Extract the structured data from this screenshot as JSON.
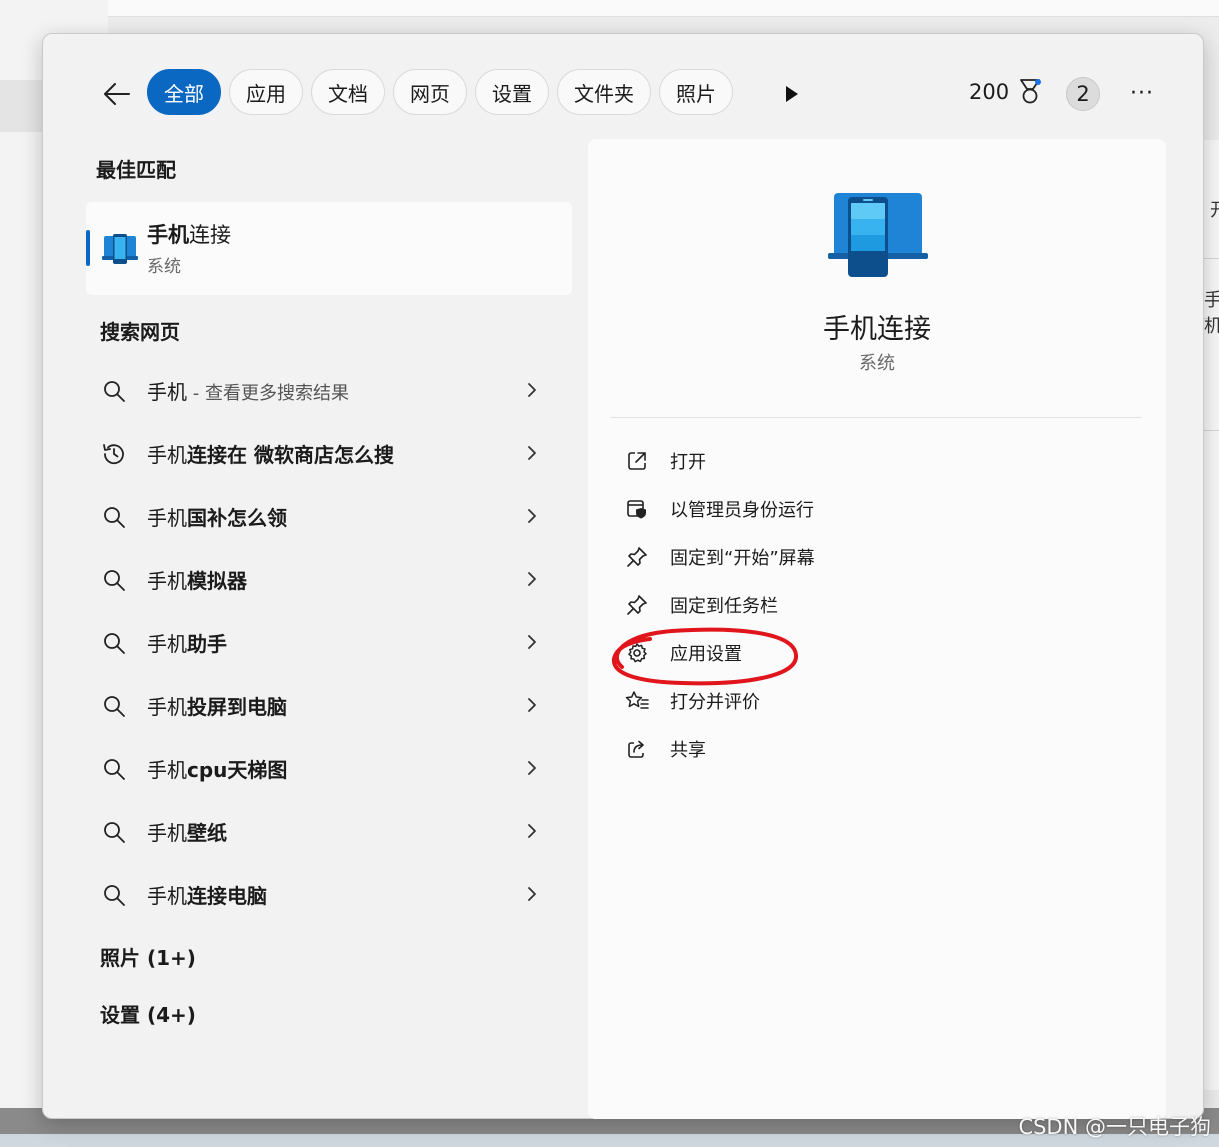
{
  "filters": {
    "chips": [
      {
        "label": "全部",
        "active": true
      },
      {
        "label": "应用",
        "active": false
      },
      {
        "label": "文档",
        "active": false
      },
      {
        "label": "网页",
        "active": false
      },
      {
        "label": "设置",
        "active": false
      },
      {
        "label": "文件夹",
        "active": false
      },
      {
        "label": "照片",
        "active": false
      }
    ],
    "points": "200",
    "badge_count": "2",
    "more_label": "···"
  },
  "best_match": {
    "heading": "最佳匹配",
    "title_bold": "手机",
    "title_rest": "连接",
    "subtitle": "系统"
  },
  "web_search": {
    "heading": "搜索网页",
    "items": [
      {
        "prefix": "手机",
        "bold": "",
        "muted": " - 查看更多搜索结果",
        "icon": "search-icon"
      },
      {
        "prefix": "手机",
        "bold": "连接在 微软商店怎么搜",
        "muted": "",
        "icon": "history-icon"
      },
      {
        "prefix": "手机",
        "bold": "国补怎么领",
        "muted": "",
        "icon": "search-icon"
      },
      {
        "prefix": "手机",
        "bold": "模拟器",
        "muted": "",
        "icon": "search-icon"
      },
      {
        "prefix": "手机",
        "bold": "助手",
        "muted": "",
        "icon": "search-icon"
      },
      {
        "prefix": "手机",
        "bold": "投屏到电脑",
        "muted": "",
        "icon": "search-icon"
      },
      {
        "prefix": "手机",
        "bold": "cpu天梯图",
        "muted": "",
        "icon": "search-icon"
      },
      {
        "prefix": "手机",
        "bold": "壁纸",
        "muted": "",
        "icon": "search-icon"
      },
      {
        "prefix": "手机",
        "bold": "连接电脑",
        "muted": "",
        "icon": "search-icon"
      }
    ]
  },
  "sections": {
    "photos": "照片 (1+)",
    "settings": "设置 (4+)"
  },
  "detail": {
    "title": "手机连接",
    "subtitle": "系统",
    "actions": [
      {
        "label": "打开",
        "icon": "open-external-icon"
      },
      {
        "label": "以管理员身份运行",
        "icon": "admin-shield-icon"
      },
      {
        "label": "固定到“开始”屏幕",
        "icon": "pin-icon"
      },
      {
        "label": "固定到任务栏",
        "icon": "pin-icon"
      },
      {
        "label": "应用设置",
        "icon": "gear-icon"
      },
      {
        "label": "打分并评价",
        "icon": "star-rate-icon"
      },
      {
        "label": "共享",
        "icon": "share-icon"
      }
    ]
  },
  "background": {
    "right_fragment_1": "开",
    "right_fragment_2": "手机"
  },
  "watermark": "CSDN @一只电子狗",
  "colors": {
    "accent": "#0a67c2",
    "annotation": "#e0161c"
  }
}
